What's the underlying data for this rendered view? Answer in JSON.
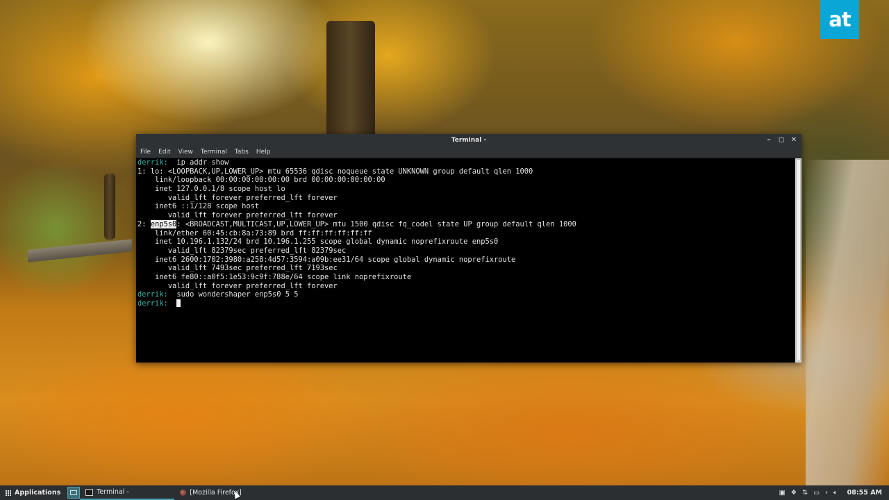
{
  "watermark": {
    "text": "at"
  },
  "terminal": {
    "window_title": "Terminal -",
    "menu": [
      "File",
      "Edit",
      "View",
      "Terminal",
      "Tabs",
      "Help"
    ],
    "prompt_user": "derrik:",
    "lines": {
      "cmd1": "ip addr show",
      "l1": "1: lo: <LOOPBACK,UP,LOWER_UP> mtu 65536 qdisc noqueue state UNKNOWN group default qlen 1000",
      "l2": "    link/loopback 00:00:00:00:00:00 brd 00:00:00:00:00:00",
      "l3": "    inet 127.0.0.1/8 scope host lo",
      "l4": "       valid_lft forever preferred_lft forever",
      "l5": "    inet6 ::1/128 scope host",
      "l6": "       valid_lft forever preferred_lft forever",
      "l7_prefix": "2: ",
      "l7_iface": "enp5s0",
      "l7_rest": ": <BROADCAST,MULTICAST,UP,LOWER_UP> mtu 1500 qdisc fq_codel state UP group default qlen 1000",
      "l8": "    link/ether 60:45:cb:8a:73:89 brd ff:ff:ff:ff:ff:ff",
      "l9": "    inet 10.196.1.132/24 brd 10.196.1.255 scope global dynamic noprefixroute enp5s0",
      "l10": "       valid_lft 82379sec preferred_lft 82379sec",
      "l11": "    inet6 2600:1702:3980:a258:4d57:3594:a09b:ee31/64 scope global dynamic noprefixroute",
      "l12": "       valid_lft 7493sec preferred_lft 7193sec",
      "l13": "    inet6 fe80::a0f5:1e53:9c9f:788e/64 scope link noprefixroute",
      "l14": "       valid_lft forever preferred_lft forever",
      "cmd2": "sudo wondershaper enp5s0 5 5"
    }
  },
  "taskbar": {
    "applications_label": "Applications",
    "tasks": [
      "Terminal -",
      "[Mozilla Firefox]"
    ],
    "clock": "08:55 AM"
  }
}
